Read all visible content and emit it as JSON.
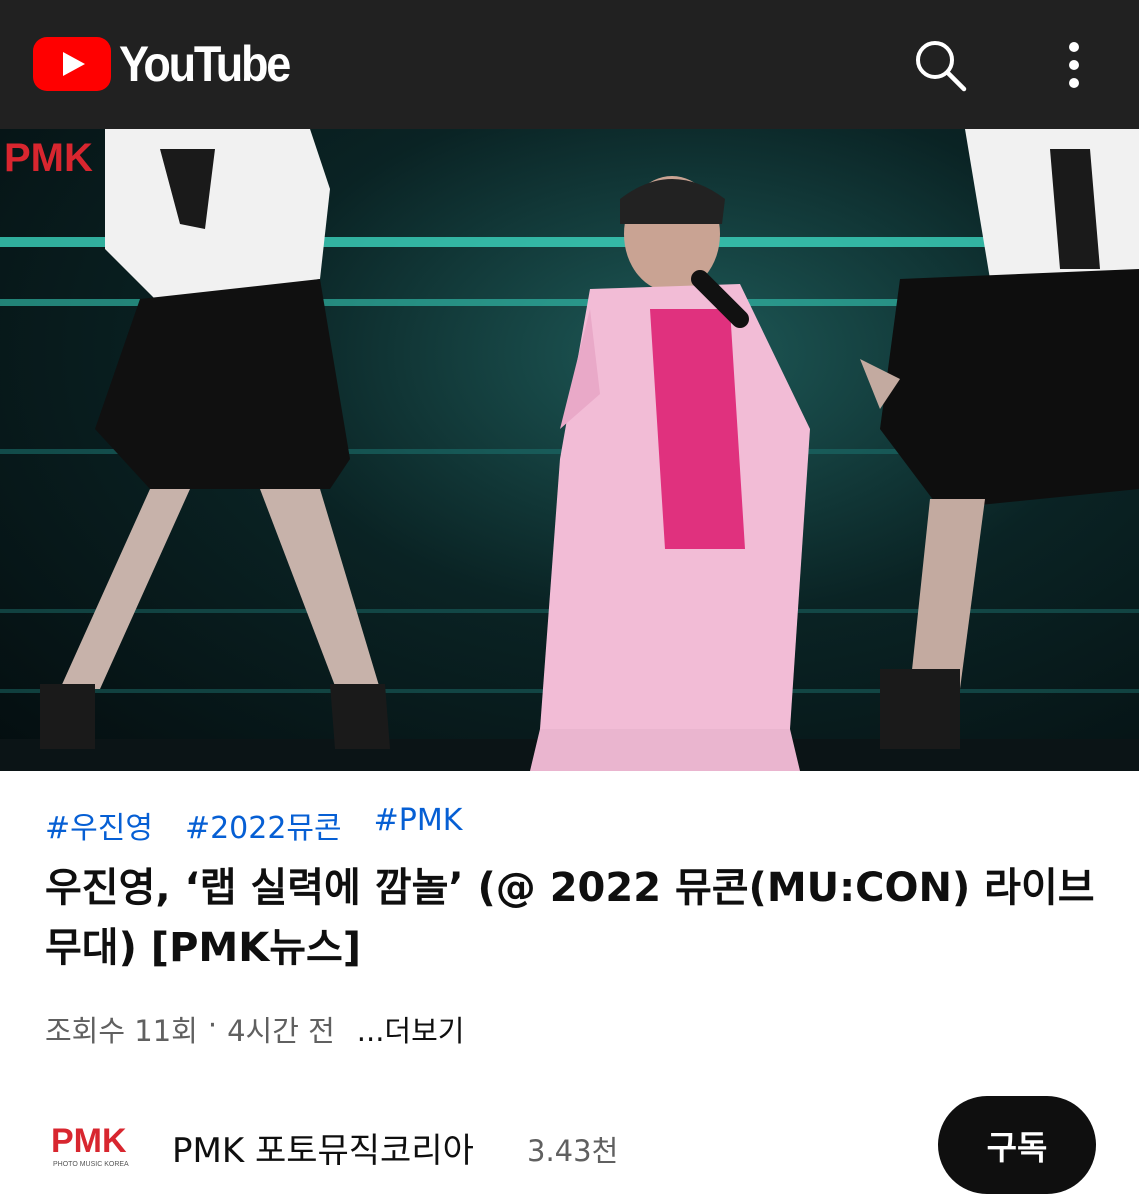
{
  "header": {
    "app_name": "YouTube",
    "search_icon": "search-icon",
    "menu_icon": "more-vert-icon"
  },
  "video": {
    "watermark": "PMK"
  },
  "hashtags": [
    "#우진영",
    "#2022뮤콘",
    "#PMK"
  ],
  "title": "우진영, ‘랩 실력에 깜놀’ (@ 2022 뮤콘(MU:CON) 라이브 무대) [PMK뉴스]",
  "meta": {
    "views": "조회수 11회",
    "separator": "·",
    "age": "4시간 전",
    "more": "...더보기"
  },
  "channel": {
    "logo_text": "PMK",
    "logo_subtext": "PHOTO MUSIC KOREA",
    "name": "PMK 포토뮤직코리아",
    "subscribers": "3.43천",
    "subscribe_label": "구독"
  },
  "colors": {
    "topbar": "#212121",
    "brand_red": "#ff0000",
    "hashtag": "#065fd4",
    "subscribe_bg": "#0f0f0f"
  }
}
